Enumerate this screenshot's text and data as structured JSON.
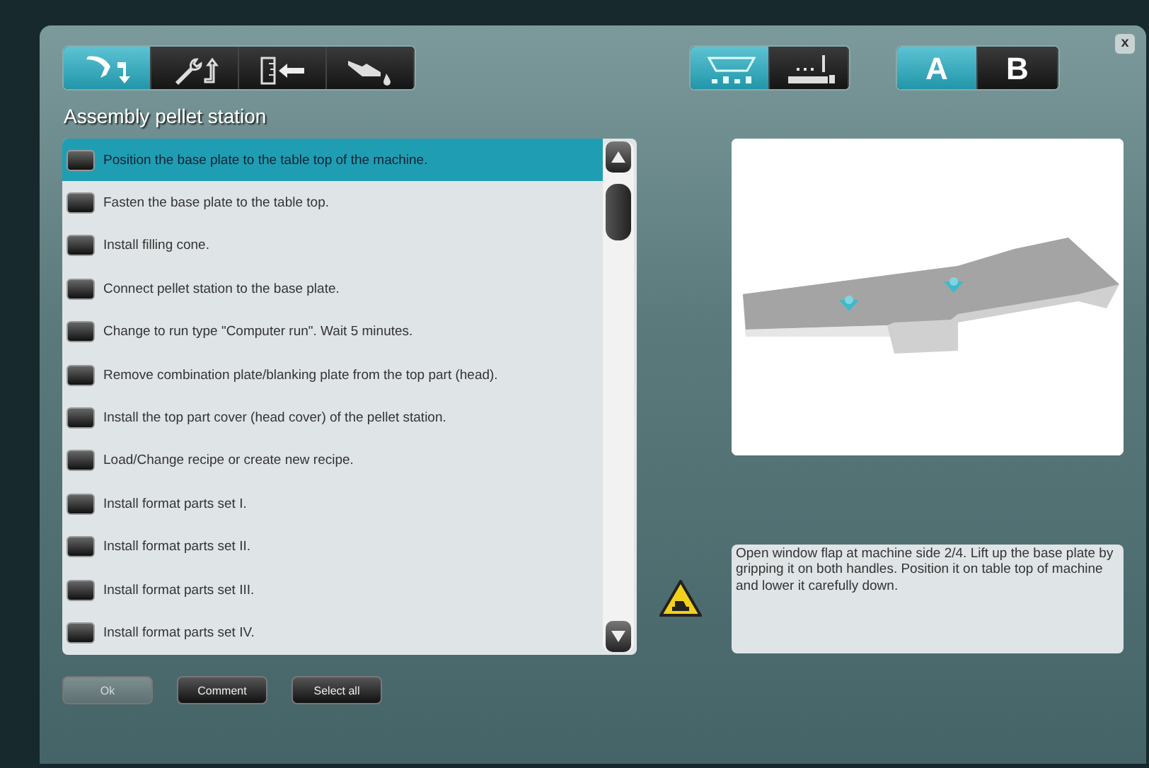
{
  "tool_tabs": [
    {
      "kind": "pick",
      "selected": true
    },
    {
      "kind": "wrench",
      "selected": false
    },
    {
      "kind": "insert",
      "selected": false
    },
    {
      "kind": "oil",
      "selected": false
    }
  ],
  "view_tabs": [
    {
      "kind": "hopper",
      "selected": true
    },
    {
      "kind": "table",
      "selected": false
    }
  ],
  "side_tabs": [
    {
      "label": "A",
      "selected": true
    },
    {
      "label": "B",
      "selected": false
    }
  ],
  "title": "Assembly pellet station",
  "steps": [
    {
      "text": "Position the base plate to the table top of the machine.",
      "selected": true
    },
    {
      "text": "Fasten the base plate to the table top.",
      "selected": false
    },
    {
      "text": "Install filling cone.",
      "selected": false
    },
    {
      "text": "Connect pellet station to the base plate.",
      "selected": false
    },
    {
      "text": "Change to run type \"Computer run\". Wait 5 minutes.",
      "selected": false
    },
    {
      "text": "Remove combination plate/blanking plate from the top part (head).",
      "selected": false
    },
    {
      "text": "Install the top part cover (head cover) of the pellet station.",
      "selected": false
    },
    {
      "text": "Load/Change recipe or create new recipe.",
      "selected": false
    },
    {
      "text": "Install format parts set I.",
      "selected": false
    },
    {
      "text": "Install format parts set II.",
      "selected": false
    },
    {
      "text": "Install format parts set III.",
      "selected": false
    },
    {
      "text": "Install format parts set IV.",
      "selected": false
    }
  ],
  "description": "Open window flap at machine side 2/4. Lift up the base plate by gripping it on both handles. Position it on table top of machine and lower it carefully down.",
  "buttons": [
    {
      "label": "Ok",
      "disabled": true
    },
    {
      "label": "Comment",
      "disabled": false
    },
    {
      "label": "Select all",
      "disabled": false
    }
  ],
  "close": "x"
}
